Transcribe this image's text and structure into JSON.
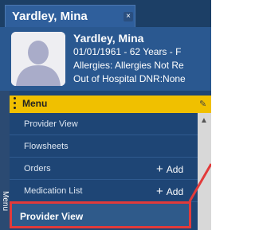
{
  "tab": {
    "title": "Yardley, Mina",
    "close_glyph": "×"
  },
  "patient": {
    "name": "Yardley, Mina",
    "dob_line": "01/01/1961 -  62 Years - F",
    "allergies": "Allergies: Allergies Not Re",
    "dnr": "Out of Hospital DNR:None"
  },
  "sidebar": {
    "vertical_label": "Menu"
  },
  "menu": {
    "title": "Menu",
    "items": [
      {
        "label": "Provider View",
        "action": ""
      },
      {
        "label": "Flowsheets",
        "action": ""
      },
      {
        "label": "Orders",
        "action": "Add"
      },
      {
        "label": "Medication List",
        "action": "Add"
      }
    ],
    "action_glyph": "+",
    "selected": {
      "label": "Provider View"
    }
  },
  "colors": {
    "title_bar": "#1c3f66",
    "banner": "#2a5890",
    "menu_header": "#f0c000",
    "menu_bg": "#1e4575",
    "highlight": "#e23a3a"
  },
  "icons": [
    "close-icon",
    "avatar-silhouette-icon",
    "drag-dots-icon",
    "pin-icon",
    "scroll-up-icon",
    "plus-icon"
  ]
}
